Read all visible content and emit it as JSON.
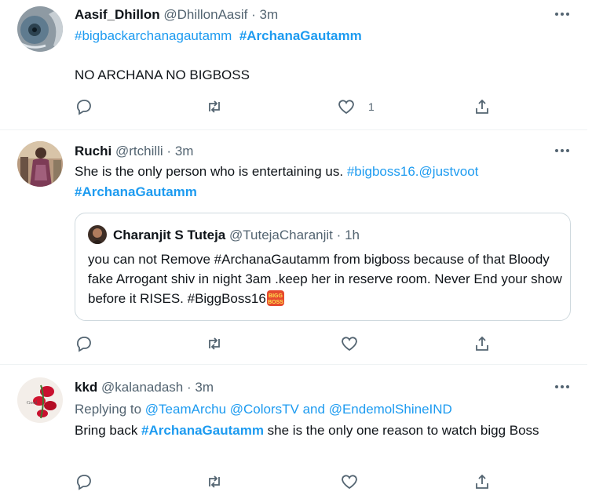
{
  "tweets": [
    {
      "name": "Aasif_Dhillon",
      "handle": "@DhillonAasif",
      "dot": "·",
      "time": "3m",
      "hashtag_plain": "#bigbackarchanagautamm",
      "hashtag_bold": "#ArchanaGautamm",
      "body": "NO ARCHANA NO BIGBOSS",
      "like_count": "1",
      "icons": [
        "reply-icon",
        "retweet-icon",
        "like-icon",
        "share-icon"
      ]
    },
    {
      "name": "Ruchi",
      "handle": "@rtchilli",
      "dot": "·",
      "time": "3m",
      "body_text": "She is the only person who is entertaining us. ",
      "link1": "#bigboss16",
      "link_sep": ".",
      "link2": "@justvoot",
      "hashtag_bold": "#ArchanaGautamm",
      "quote": {
        "name": "Charanjit S Tuteja",
        "handle": "@TutejaCharanjit",
        "dot": "·",
        "time": "1h",
        "body": "you can not Remove #ArchanaGautamm  from bigboss because of that Bloody fake Arrogant shiv in night 3am .keep her in reserve room. Never End your show before it RISES. #BiggBoss16",
        "badge_text": "BIGG BOSS"
      }
    },
    {
      "name": "kkd",
      "handle": "@kalanadash",
      "dot": "·",
      "time": "3m",
      "replying_prefix": "Replying to ",
      "reply_to_1": "@TeamArchu",
      "reply_to_2": "@ColorsTV",
      "reply_and": " and ",
      "reply_to_3": "@EndemolShineIND",
      "body_prefix": "Bring back ",
      "hashtag_bold": "#ArchanaGautamm",
      "body_suffix": " she is the only one reason to watch bigg Boss"
    }
  ],
  "colors": {
    "accent": "#1d9bf0",
    "text": "#0f1419",
    "muted": "#536471",
    "divider": "#eff3f4"
  }
}
